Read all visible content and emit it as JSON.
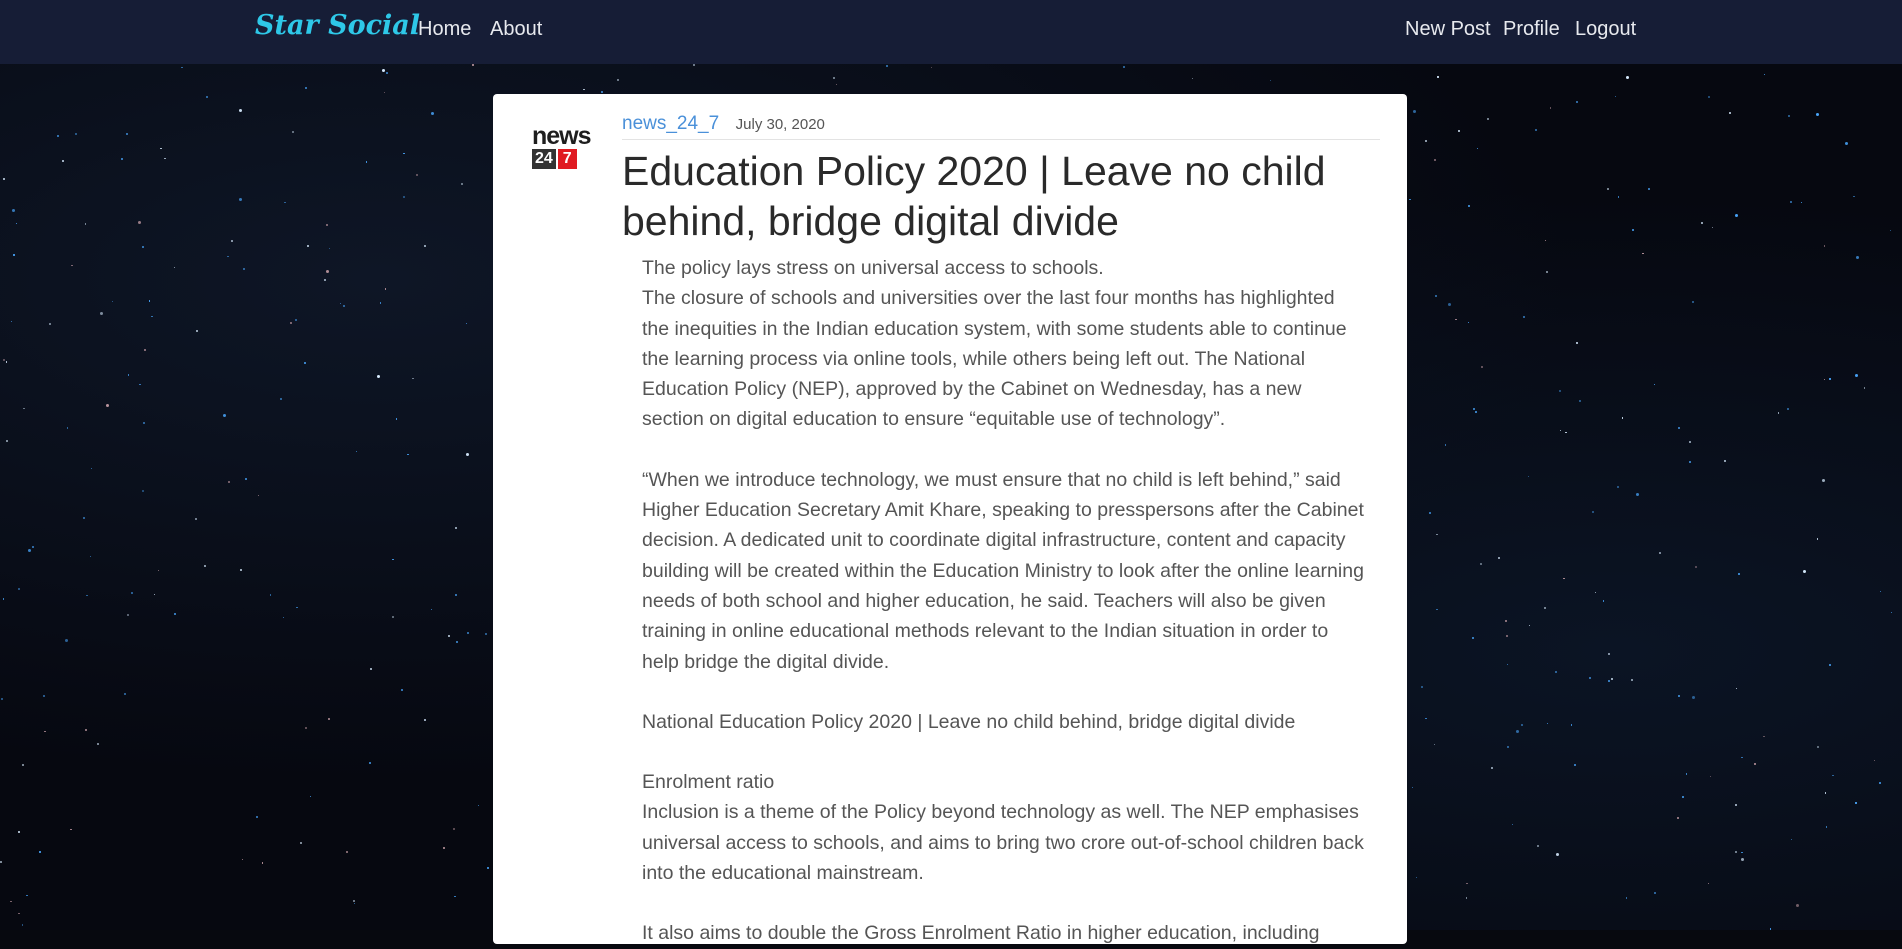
{
  "nav": {
    "brand": "Star Social",
    "left_links": [
      "Home",
      "About"
    ],
    "right_links": [
      "New Post",
      "Profile",
      "Logout"
    ]
  },
  "post": {
    "logo": {
      "word": "news",
      "badge_number": "24",
      "badge_accent": "7"
    },
    "author": "news_24_7",
    "date": "July 30, 2020",
    "title": "Education Policy 2020 | Leave no child behind, bridge digital divide",
    "paragraphs": [
      "The policy lays stress on universal access to schools.",
      "The closure of schools and universities over the last four months has highlighted the inequities in the Indian education system, with some students able to continue the learning process via online tools, while others being left out. The National Education Policy (NEP), approved by the Cabinet on Wednesday, has a new section on digital education to ensure “equitable use of technology”.",
      "“When we introduce technology, we must ensure that no child is left behind,” said Higher Education Secretary Amit Khare, speaking to presspersons after the Cabinet decision. A dedicated unit to coordinate digital infrastructure, content and capacity building will be created within the Education Ministry to look after the online learning needs of both school and higher education, he said. Teachers will also be given training in online educational methods relevant to the Indian situation in order to help bridge the digital divide.",
      "National Education Policy 2020 | Leave no child behind, bridge digital divide",
      "Enrolment ratio",
      "Inclusion is a theme of the Policy beyond technology as well. The NEP emphasises universal access to schools, and aims to bring two crore out-of-school children back into the educational mainstream.",
      "It also aims to double the Gross Enrolment Ratio in higher education, including"
    ]
  },
  "colors": {
    "navbar_bg": "#161d36",
    "brand": "#2ec8e8",
    "author_link": "#4a90d9",
    "logo_accent": "#e01b22"
  }
}
